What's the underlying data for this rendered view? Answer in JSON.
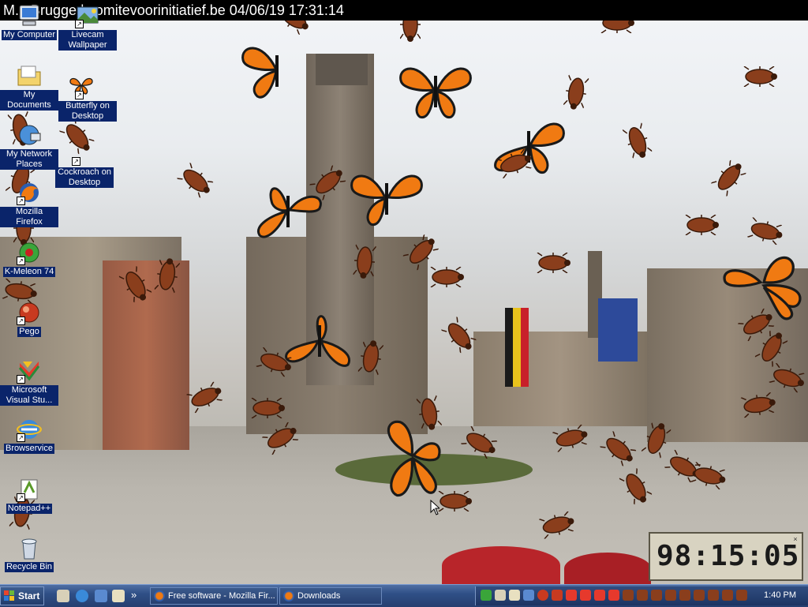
{
  "caption": {
    "text": "M... Brugge | comitevoorinitiatief.be 04/06/19 17:31:14"
  },
  "desktop_icons": [
    {
      "label": "My Computer",
      "icon": "computer-icon"
    },
    {
      "label": "Livecam Wallpaper",
      "icon": "livecam-icon"
    },
    {
      "label": "My Documents",
      "icon": "folder-icon"
    },
    {
      "label": "Butterfly on Desktop",
      "icon": "butterfly-icon"
    },
    {
      "label": "My Network Places",
      "icon": "network-icon"
    },
    {
      "label": "Cockroach on Desktop",
      "icon": "cockroach-icon"
    },
    {
      "label": "Mozilla Firefox",
      "icon": "firefox-icon"
    },
    {
      "label": "K-Meleon 74",
      "icon": "kmeleon-icon"
    },
    {
      "label": "Pego",
      "icon": "pego-icon"
    },
    {
      "label": "Microsoft Visual Stu...",
      "icon": "visual-studio-icon"
    },
    {
      "label": "Browservice",
      "icon": "browservice-icon"
    },
    {
      "label": "Notepad++",
      "icon": "notepad-plus-plus-icon"
    },
    {
      "label": "Recycle Bin",
      "icon": "recycle-bin-icon"
    }
  ],
  "clock_widget": {
    "digits": "98:15:05"
  },
  "taskbar": {
    "start_label": "Start",
    "tasks": [
      {
        "label": "Free software - Mozilla Fir...",
        "icon": "firefox-icon"
      },
      {
        "label": "Downloads",
        "icon": "firefox-icon"
      }
    ],
    "time": "1:40 PM",
    "overflow_chevron": "»"
  },
  "colors": {
    "caption_bg": "#000000",
    "taskbar_bg": "#2f4f86",
    "icon_label_bg": "#0a246a",
    "butterfly_orange": "#f07a12",
    "roach_brown": "#8a3e1c",
    "clock_bg": "#d8d3c1"
  }
}
